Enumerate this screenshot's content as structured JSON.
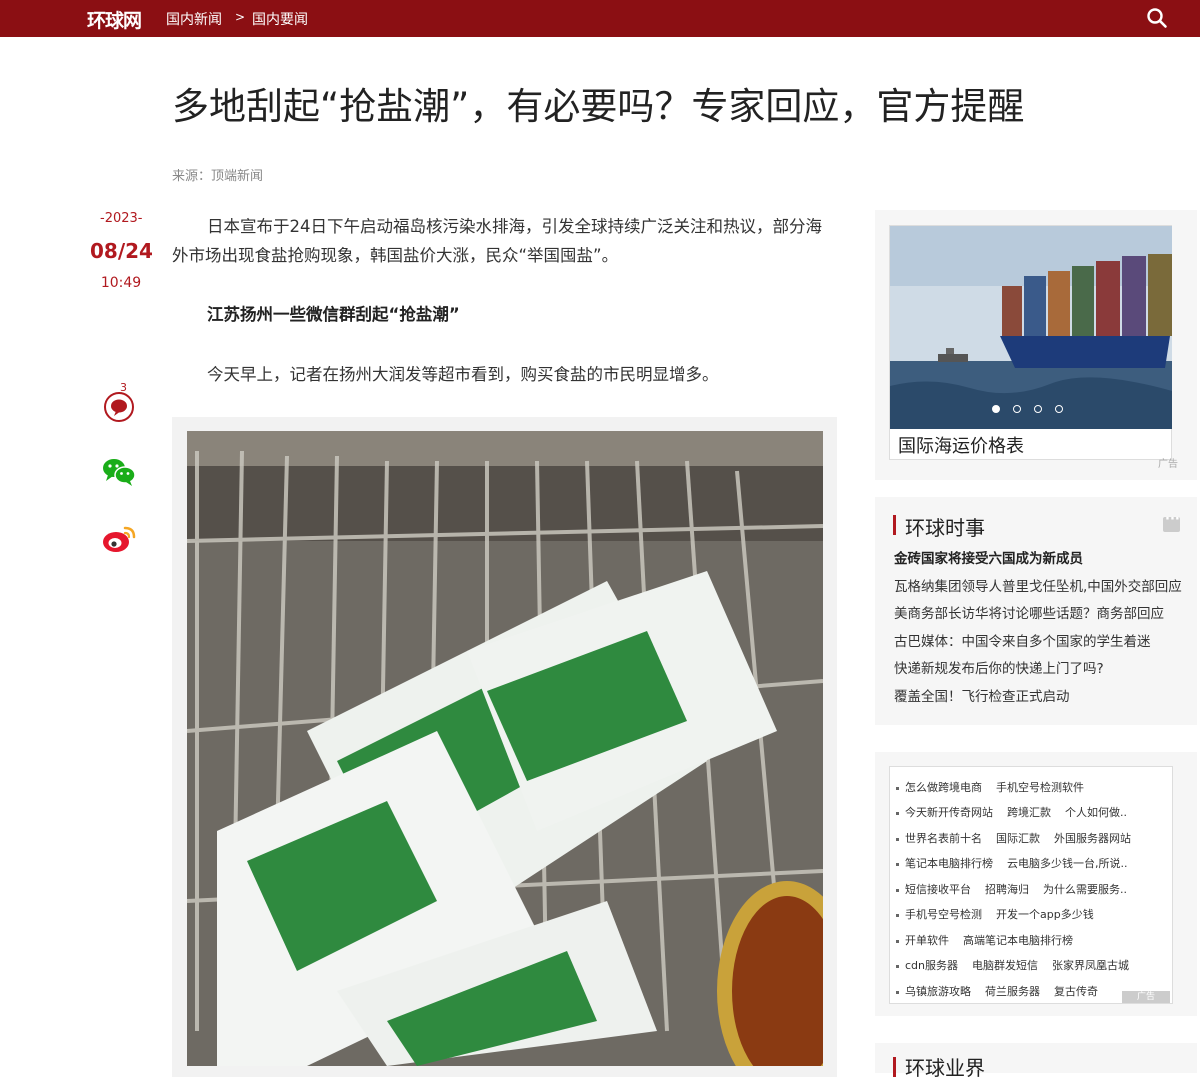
{
  "header": {
    "logo": "环球网",
    "breadcrumb": [
      "国内新闻",
      ">",
      "国内要闻"
    ],
    "icons": {
      "search": "search-icon"
    },
    "colors": {
      "brand": "#8b0f13",
      "accent": "#b1191f"
    }
  },
  "article": {
    "title": "多地刮起“抢盐潮”，有必要吗？专家回应，官方提醒",
    "source": "来源：顶端新闻",
    "date": {
      "year": "-2023-",
      "day": "08/24",
      "time": "10:49"
    },
    "comment_count": "3",
    "share_icons": [
      "comment-icon",
      "wechat-icon",
      "weibo-icon"
    ],
    "paragraphs": [
      "日本宣布于24日下午启动福岛核污染水排海，引发全球持续广泛关注和热议，部分海外市场出现食盐抢购现象，韩国盐价大涨，民众“举国囤盐”。",
      "江苏扬州一些微信群刮起“抢盐潮”",
      "今天早上，记者在扬州大润发等超市看到，购买食盐的市民明显增多。"
    ]
  },
  "sidebar": {
    "ad": {
      "caption": "国际海运价格表",
      "label": "广告",
      "slide_count": 4,
      "active_slide": 1
    },
    "news": {
      "title": "环球时事",
      "items": [
        "金砖国家将接受六国成为新成员",
        "瓦格纳集团领导人普里戈任坠机,中国外交部回应",
        "美商务部长访华将讨论哪些话题？商务部回应",
        "古巴媒体：中国令来自多个国家的学生着迷",
        "快递新规发布后你的快递上门了吗?",
        "覆盖全国！飞行检查正式启动"
      ]
    },
    "links": {
      "rows": [
        [
          "怎么做跨境电商",
          "手机空号检测软件"
        ],
        [
          "今天新开传奇网站",
          "跨境汇款",
          "个人如何做.."
        ],
        [
          "世界名表前十名",
          "国际汇款",
          "外国服务器网站"
        ],
        [
          "笔记本电脑排行榜",
          "云电脑多少钱一台,所说.."
        ],
        [
          "短信接收平台",
          "招聘海归",
          "为什么需要服务.."
        ],
        [
          "手机号空号检测",
          "开发一个app多少钱"
        ],
        [
          "开单软件",
          "高端笔记本电脑排行榜"
        ],
        [
          "cdn服务器",
          "电脑群发短信",
          "张家界凤凰古城"
        ],
        [
          "乌镇旅游攻略",
          "荷兰服务器",
          "复古传奇"
        ]
      ],
      "ad_label": "广告"
    },
    "next_section": "环球业界"
  }
}
